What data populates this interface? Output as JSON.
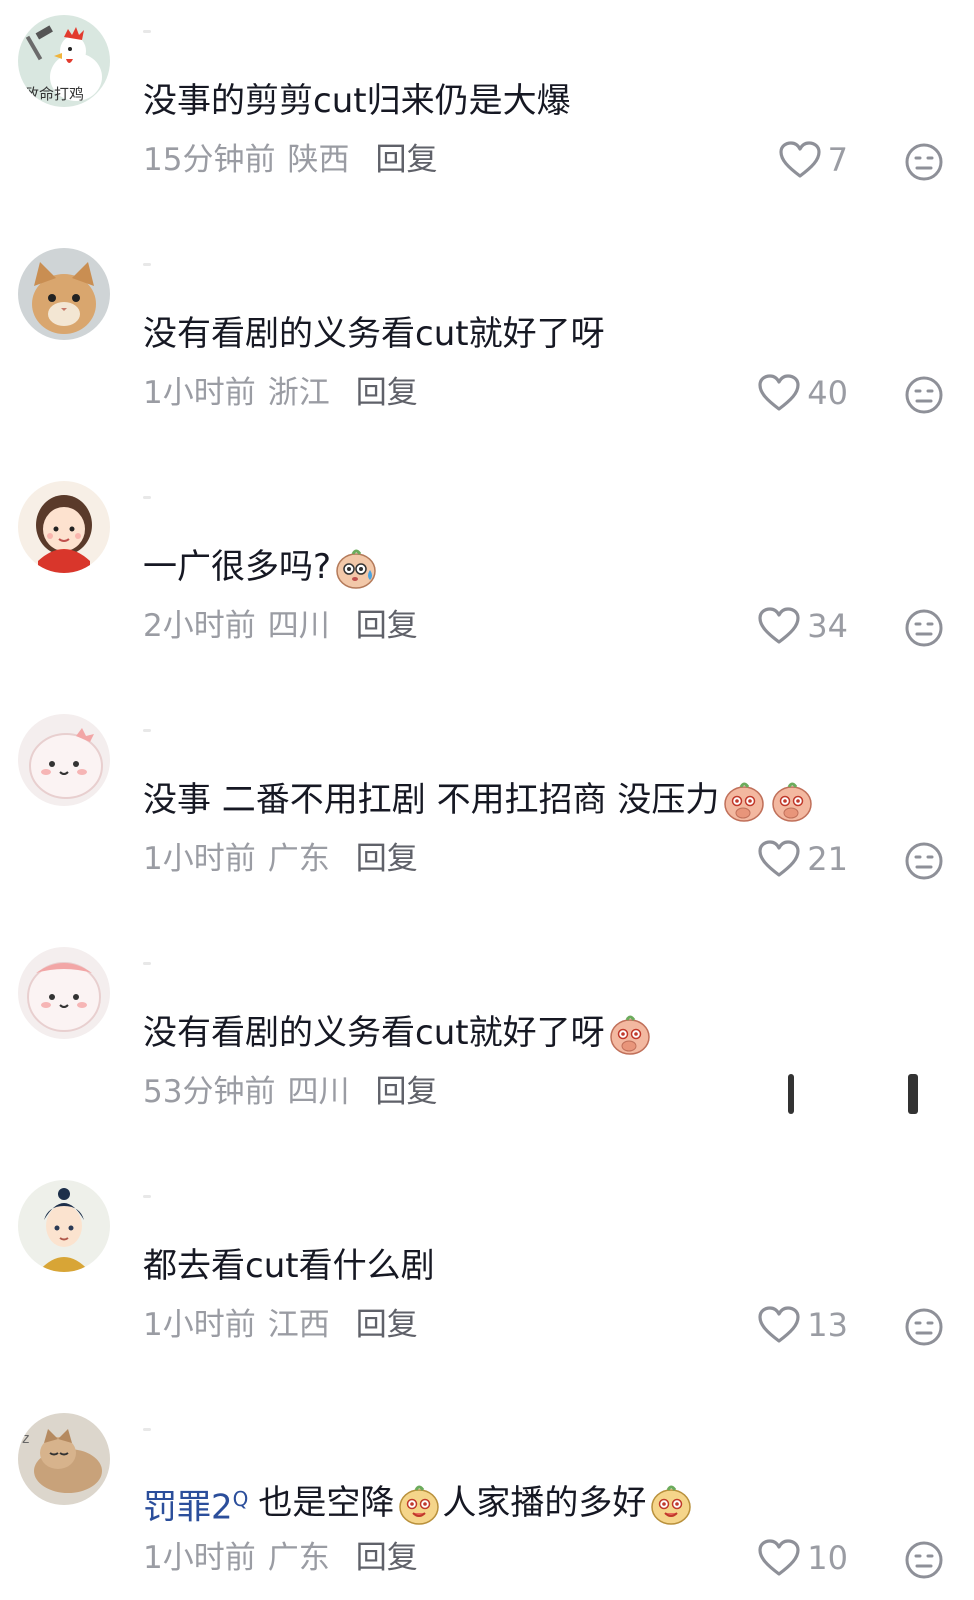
{
  "comments": [
    {
      "text": "没事的剪剪cut归来仍是大爆",
      "time": "15分钟前",
      "location": "陕西",
      "reply_label": "回复",
      "likes": "7",
      "avatar": "rooster-avatar",
      "avatar_text": "致命打鸡",
      "emojis": []
    },
    {
      "text": "没有看剧的义务看cut就好了呀",
      "time": "1小时前",
      "location": "浙江",
      "reply_label": "回复",
      "likes": "40",
      "avatar": "cat-avatar",
      "emojis": []
    },
    {
      "text": "一广很多吗?",
      "time": "2小时前",
      "location": "四川",
      "reply_label": "回复",
      "likes": "34",
      "avatar": "cartoon-girl-avatar",
      "emojis": [
        "sweat-emoji"
      ]
    },
    {
      "text": "没事 二番不用扛剧 不用扛招商 没压力",
      "time": "1小时前",
      "location": "广东",
      "reply_label": "回复",
      "likes": "21",
      "avatar": "pink-blob-avatar",
      "emojis": [
        "shy-emoji",
        "shy-emoji"
      ]
    },
    {
      "text": "没有看剧的义务看cut就好了呀",
      "time": "53分钟前",
      "location": "四川",
      "reply_label": "回复",
      "likes": "",
      "avatar": "pink-blob-avatar",
      "emojis": [
        "shy-emoji"
      ]
    },
    {
      "text": "都去看cut看什么剧",
      "time": "1小时前",
      "location": "江西",
      "reply_label": "回复",
      "likes": "13",
      "avatar": "anime-warrior-avatar",
      "emojis": []
    },
    {
      "mention": "罚罪2",
      "text_part1": "也是空降",
      "text_part2": "人家播的多好",
      "time": "1小时前",
      "location": "广东",
      "reply_label": "回复",
      "likes": "10",
      "avatar": "lying-cat-avatar",
      "emojis": [
        "smirk-emoji",
        "smirk-emoji"
      ]
    }
  ],
  "colors": {
    "text": "#161823",
    "meta": "#9a9ca3",
    "reply": "#5f6169",
    "mention": "#2b4e9b"
  }
}
